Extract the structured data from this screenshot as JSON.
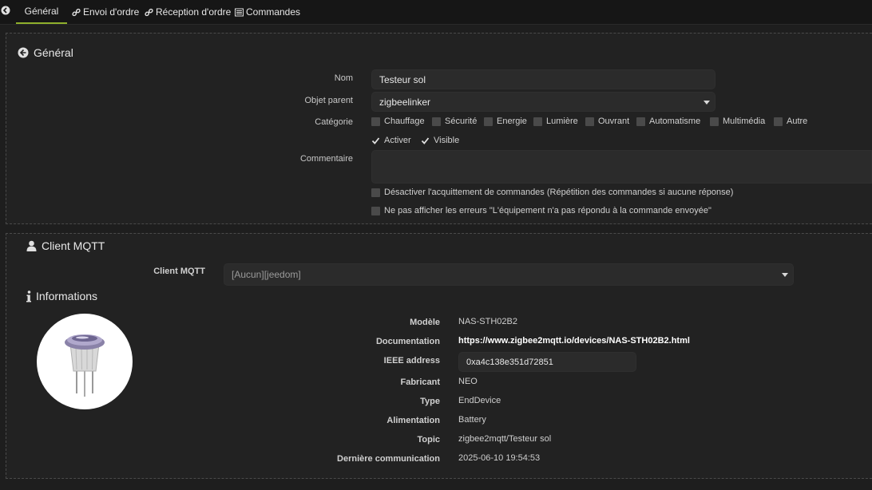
{
  "tabs": [
    {
      "label": "Général",
      "icon": "back-arrow-icon"
    },
    {
      "label": "Envoi d'ordre",
      "icon": "link-icon"
    },
    {
      "label": "Réception d'ordre",
      "icon": "link-icon"
    },
    {
      "label": "Commandes",
      "icon": "list-icon"
    }
  ],
  "general": {
    "title": "Général",
    "nom_label": "Nom",
    "nom_value": "Testeur sol",
    "objet_label": "Objet parent",
    "objet_value": "zigbeelinker",
    "categorie_label": "Catégorie",
    "categories": [
      "Chauffage",
      "Sécurité",
      "Energie",
      "Lumière",
      "Ouvrant",
      "Automatisme",
      "Multimédia",
      "Autre"
    ],
    "activer_label": "Activer",
    "visible_label": "Visible",
    "commentaire_label": "Commentaire",
    "ack_label": "Désactiver l'acquittement de commandes (Répétition des commandes si aucune réponse)",
    "errors_label": "Ne pas afficher les erreurs \"L'équipement n'a pas répondu à la commande envoyée\""
  },
  "mqtt": {
    "title": "Client MQTT",
    "client_label": "Client MQTT",
    "client_value": "[Aucun][jeedom]"
  },
  "info": {
    "title": "Informations",
    "rows": [
      {
        "label": "Modèle",
        "value": "NAS-STH02B2"
      },
      {
        "label": "Documentation",
        "value": "https://www.zigbee2mqtt.io/devices/NAS-STH02B2.html"
      },
      {
        "label": "IEEE address",
        "value": "0xa4c138e351d72851"
      },
      {
        "label": "Fabricant",
        "value": "NEO"
      },
      {
        "label": "Type",
        "value": "EndDevice"
      },
      {
        "label": "Alimentation",
        "value": "Battery"
      },
      {
        "label": "Topic",
        "value": "zigbee2mqtt/Testeur sol"
      },
      {
        "label": "Dernière communication",
        "value": "2025-06-10 19:54:53"
      }
    ]
  }
}
